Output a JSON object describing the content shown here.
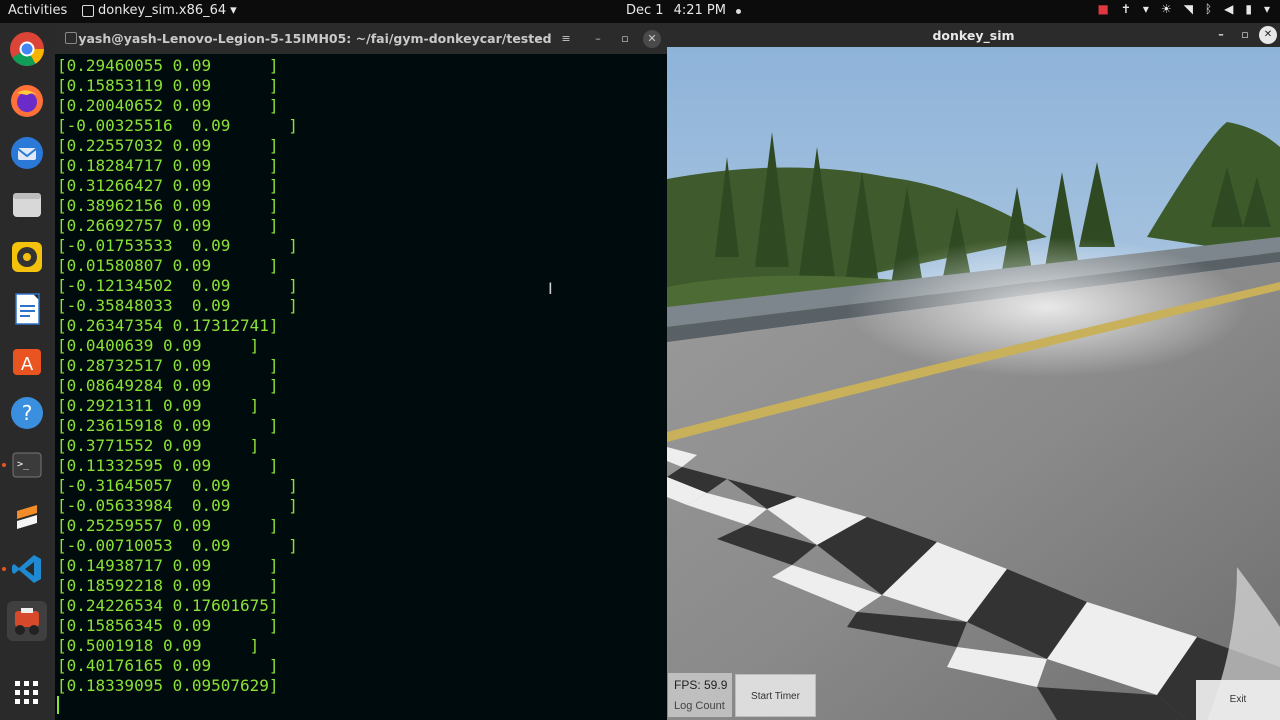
{
  "topbar": {
    "activities": "Activities",
    "app_name": "donkey_sim.x86_64",
    "app_arrow": "▾",
    "date": "Dec 1",
    "time": "4:21 PM",
    "tray_icons": [
      "camera-record-icon",
      "accessibility-icon",
      "brightness-icon",
      "wifi-icon",
      "bluetooth-icon",
      "volume-icon",
      "battery-icon"
    ],
    "tray_glyphs": [
      "■",
      "✝",
      "☀",
      "◥",
      "ᛒ",
      "◀",
      "▮"
    ],
    "arrow": "▾"
  },
  "dock": {
    "apps": [
      {
        "name": "chrome-icon",
        "color": "#db4437"
      },
      {
        "name": "firefox-icon",
        "color": "#ff7139"
      },
      {
        "name": "thunderbird-icon",
        "color": "#2a79d6"
      },
      {
        "name": "files-icon",
        "color": "#d6d6d6"
      },
      {
        "name": "rhythmbox-icon",
        "color": "#f4c20d"
      },
      {
        "name": "writer-icon",
        "color": "#2f73c8"
      },
      {
        "name": "software-icon",
        "color": "#e95420"
      },
      {
        "name": "help-icon",
        "color": "#3a8fde"
      },
      {
        "name": "terminal-icon",
        "color": "#3b3b3b"
      },
      {
        "name": "sublime-icon",
        "color": "#f28c28"
      },
      {
        "name": "vscode-icon",
        "color": "#1f8ad2"
      },
      {
        "name": "donkey-sim-icon",
        "color": "#d64a2b"
      },
      {
        "name": "show-apps-icon",
        "color": "#ffffff"
      }
    ]
  },
  "terminal": {
    "title": "yash@yash-Lenovo-Legion-5-15IMH05: ~/fai/gym-donkeycar/tested",
    "lines": [
      "[0.29460055 0.09      ]",
      "[0.15853119 0.09      ]",
      "[0.20040652 0.09      ]",
      "[-0.00325516  0.09      ]",
      "[0.22557032 0.09      ]",
      "[0.18284717 0.09      ]",
      "[0.31266427 0.09      ]",
      "[0.38962156 0.09      ]",
      "[0.26692757 0.09      ]",
      "[-0.01753533  0.09      ]",
      "[0.01580807 0.09      ]",
      "[-0.12134502  0.09      ]",
      "[-0.35848033  0.09      ]",
      "[0.26347354 0.17312741]",
      "[0.0400639 0.09     ]",
      "[0.28732517 0.09      ]",
      "[0.08649284 0.09      ]",
      "[0.2921311 0.09     ]",
      "[0.23615918 0.09      ]",
      "[0.3771552 0.09     ]",
      "[0.11332595 0.09      ]",
      "[-0.31645057  0.09      ]",
      "[-0.05633984  0.09      ]",
      "[0.25259557 0.09      ]",
      "[-0.00710053  0.09      ]",
      "[0.14938717 0.09      ]",
      "[0.18592218 0.09      ]",
      "[0.24226534 0.17601675]",
      "[0.15856345 0.09      ]",
      "[0.5001918 0.09     ]",
      "[0.40176165 0.09      ]",
      "[0.18339095 0.09507629]"
    ]
  },
  "sim": {
    "title": "donkey_sim",
    "fps_label": "FPS: 59.9",
    "log_count_label": "Log Count",
    "start_timer_label": "Start Timer",
    "exit_label": "Exit"
  },
  "window_controls": {
    "minimize": "–",
    "maximize": "▫",
    "close": "✕",
    "search": "⌕",
    "menu": "≡"
  }
}
